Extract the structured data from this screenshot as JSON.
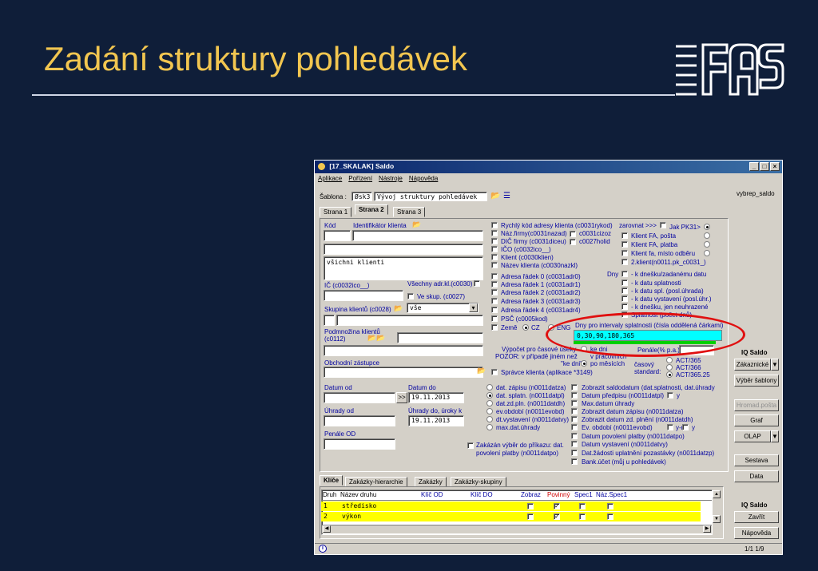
{
  "slide": {
    "title": "Zadání struktury pohledávek"
  },
  "window": {
    "title": "[17_SKALAK] Saldo",
    "menu": [
      "Aplikace",
      "Pořízení",
      "Nástroje",
      "Nápověda"
    ],
    "template_label": "Šablona :",
    "template_code": "Øsk3",
    "template_name": "Vývoj struktury pohledávek",
    "tabs": [
      "Strana 1",
      "Strana 2",
      "Strana 3"
    ],
    "left": {
      "kod": "Kód",
      "ident": "Identifikátor klienta",
      "all_clients": "všichni klienti",
      "ic": "IČ (c0032ico__)",
      "all_adr": "Všechny adr.kl.(c0030)",
      "ve_skup": "Ve skup. (c0027)",
      "skupina": "Skupina klientů (c0028)",
      "skupina_val": "vše",
      "podmnozina": "Podmnožina klientů (c0112)",
      "obchodni": "Obchodní zástupce",
      "datum_od": "Datum od",
      "datum_do": "Datum do",
      "datum_do_val": "19.11.2013",
      "uhrady_od": "Úhrady od",
      "uhrady_do": "Úhrady do, úroky k",
      "uhrady_do_val": "19.11.2013",
      "penale_od": "Penále OD",
      "zakazan": "Zakázán výběr do příkazu: dat. povolení platby (n0011datpo)"
    },
    "col2": [
      "Rychlý kód adresy klienta (c0031rykod)",
      "Náz.firmy(c0031nazad)",
      "DIČ firmy (c0031diceu)",
      "IČO (c0032ico__)",
      "Klient (c0030klien)",
      "Název klienta (c0030nazkl)",
      "Adresa řádek 0 (c0031adr0)",
      "Adresa řádek 1 (c0031adr1)",
      "Adresa řádek 2 (c0031adr2)",
      "Adresa řádek 3 (c0031adr3)",
      "Adresa řádek 4 (c0031adr4)",
      "PSČ (c0005kod)"
    ],
    "col2b": {
      "cizoz": "c0031cizoz",
      "holid": "c0027holid",
      "zeme": "Země",
      "cz": "CZ",
      "eng": "ENG"
    },
    "col3": {
      "zarovnat": "zarovnat >>>",
      "jak": "Jak PK31>",
      "klient_fa_posta": "Klient FA, pošta",
      "klient_fa_platba": "Klient FA, platba",
      "klient_fa_misto": "Klient fa, místo odběru",
      "klient2": "2.klient(n0011.pk_c0031_)",
      "dny": "Dny",
      "k_dnesku": "- k dnešku/zadanému datu",
      "k_datu_splat": "- k datu splatnosti",
      "k_datu_spl": "- k datu spl. (posl.úhrada)",
      "k_datu_vyst": "- k datu vystavení (posl.úhr.)",
      "k_dnesku_jen": "- k dnešku, jen neuhrazené",
      "splatnost": "Splatnost (počet dnů)",
      "intervals_label": "Dny pro intervaly splatnosti (čísla oddělená čárkami)",
      "intervals_value": "0,30,90,180,365"
    },
    "calc": {
      "vypocet": "Výpočet pro časové úseky",
      "pozor": "POZOR: v případě jiném než",
      "ke_dni": "ke dni",
      "v_pracovnich": "v pracovních",
      "ke_dni_q": "\"ke dni\"",
      "po_mesicich": "po měsících",
      "penale": "Penále(% p.a.)",
      "casovy": "časový standard:",
      "act365": "ACT/365",
      "act366": "ACT/366",
      "act36525": "ACT/365.25",
      "spravce": "Správce klienta (aplikace *3149)"
    },
    "dates": [
      "dat. zápisu (n0011datza)",
      "dat. splatn. (n0011datpl)",
      "dat.zd.pln. (n0011datdh)",
      "ev.období (n0011evobd)",
      "dt.vystavení (n0011datvy)",
      "max.dat.úhrady"
    ],
    "dates2": [
      "Zobrazit saldodatum (dat.splatnosti, dat.úhrady",
      "Datum předpisu (n0011datpl)",
      "Max.datum úhrady",
      "Zobrazit datum zápisu (n0011datza)",
      "Zobrazit datum zd. plnění (n0011datdh)",
      "Ev. období (n0011evobd)",
      "Datum povolení platby (n0011datpo)",
      "Datum vystavení (n0011datvy)",
      "Dat.žádosti uplatnění pozastávky (n0011datzp)",
      "Bank.účet (můj u pohledávek)"
    ],
    "y_label": "y",
    "ym_label": "y-m",
    "bottom_tabs": [
      "Klíče",
      "Zakázky-hierarchie",
      "Zakázky",
      "Zakázky-skupiny"
    ],
    "grid_headers": [
      "Druh",
      "Název druhu",
      "Klíč OD",
      "Klíč DO",
      "Zobraz",
      "Povinný",
      "Spec1",
      "Náz.Spec1"
    ],
    "grid_rows": [
      {
        "druh": "1",
        "nazev": "středisko"
      },
      {
        "druh": "2",
        "nazev": "výkon"
      }
    ],
    "right_panel": {
      "vybrep": "vybrep_saldo",
      "iq1": "IQ Saldo",
      "zakaznicke": "Zákaznické",
      "vyber_sablony": "Výběr šablony",
      "hromad": "Hromad.pošta",
      "graf": "Graf",
      "olap": "OLAP",
      "sestava": "Sestava",
      "data": "Data",
      "iq2": "IQ Saldo",
      "zavrit": "Zavřít",
      "napoveda": "Nápověda",
      "page": "1/1  1/9"
    },
    "status_icon": "info-icon"
  }
}
